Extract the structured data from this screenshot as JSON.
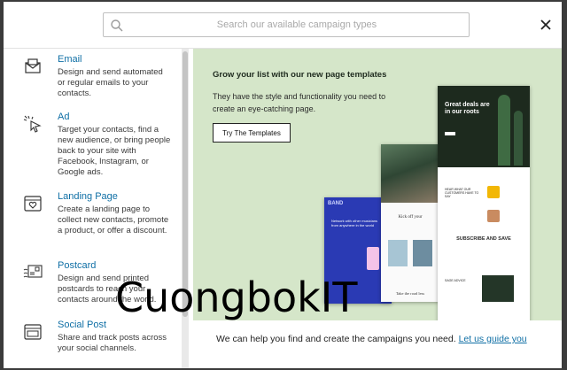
{
  "search": {
    "placeholder": "Search our available campaign types"
  },
  "sidebar": {
    "items": [
      {
        "title": "Email",
        "desc": "Design and send automated or regular emails to your contacts.",
        "icon": "mail-icon"
      },
      {
        "title": "Ad",
        "desc": "Target your contacts, find a new audience, or bring people back to your site with Facebook, Instagram, or Google ads.",
        "icon": "cursor-click-icon"
      },
      {
        "title": "Landing Page",
        "desc": "Create a landing page to collect new contacts, promote a product, or offer a discount.",
        "icon": "browser-heart-icon"
      },
      {
        "title": "Postcard",
        "desc": "Design and send printed postcards to reach your contacts around the world.",
        "icon": "postcard-icon"
      },
      {
        "title": "Social Post",
        "desc": "Share and track posts across your social channels.",
        "icon": "social-post-icon"
      }
    ]
  },
  "promo": {
    "headline": "Grow your list with our new page templates",
    "sub": "They have the style and functionality you need to create an eye-catching page.",
    "cta": "Try The Templates",
    "previews": {
      "a_tag": "BAND",
      "a_text": "Network with other musicians from anywhere in the world",
      "b_kick": "Kick off your",
      "b_take": "Take the road less",
      "c_title": "Great deals are in our roots",
      "c_hear": "HEAR WHAT OUR CUSTOMERS HAVE TO SAY",
      "c_subscribe": "SUBSCRIBE AND SAVE",
      "c_sage": "SAGE ADVICE"
    }
  },
  "footer": {
    "help_text": "We can help you find and create the campaigns you need.",
    "guide_link": "Let us guide you"
  },
  "watermark": "CuongbokIT",
  "colors": {
    "link": "#0f6fa5",
    "panel_bg": "#d5e6c9"
  }
}
